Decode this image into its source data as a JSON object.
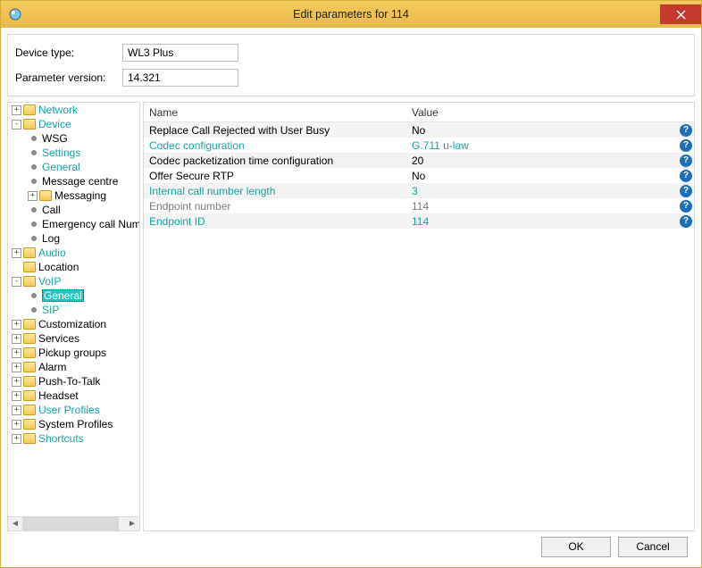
{
  "window": {
    "title": "Edit parameters for 114"
  },
  "info": {
    "device_type_label": "Device type:",
    "device_type_value": "WL3 Plus",
    "param_version_label": "Parameter version:",
    "param_version_value": "14.321"
  },
  "tree": {
    "items": [
      {
        "depth": 0,
        "exp": "+",
        "kind": "folder",
        "label": "Network",
        "link": true
      },
      {
        "depth": 0,
        "exp": "-",
        "kind": "folder",
        "label": "Device",
        "link": true
      },
      {
        "depth": 1,
        "exp": "",
        "kind": "leaf",
        "label": "WSG"
      },
      {
        "depth": 1,
        "exp": "",
        "kind": "leaf",
        "label": "Settings",
        "link": true
      },
      {
        "depth": 1,
        "exp": "",
        "kind": "leaf",
        "label": "General",
        "link": true
      },
      {
        "depth": 1,
        "exp": "",
        "kind": "leaf",
        "label": "Message centre"
      },
      {
        "depth": 1,
        "exp": "+",
        "kind": "folder",
        "label": "Messaging"
      },
      {
        "depth": 1,
        "exp": "",
        "kind": "leaf",
        "label": "Call"
      },
      {
        "depth": 1,
        "exp": "",
        "kind": "leaf",
        "label": "Emergency call Num"
      },
      {
        "depth": 1,
        "exp": "",
        "kind": "leaf",
        "label": "Log"
      },
      {
        "depth": 0,
        "exp": "+",
        "kind": "folder",
        "label": "Audio",
        "link": true
      },
      {
        "depth": 0,
        "exp": "",
        "kind": "folder",
        "label": "Location"
      },
      {
        "depth": 0,
        "exp": "-",
        "kind": "folder",
        "label": "VoIP",
        "link": true
      },
      {
        "depth": 1,
        "exp": "",
        "kind": "leaf",
        "label": "General",
        "selected": true
      },
      {
        "depth": 1,
        "exp": "",
        "kind": "leaf",
        "label": "SIP",
        "link": true
      },
      {
        "depth": 0,
        "exp": "+",
        "kind": "folder",
        "label": "Customization"
      },
      {
        "depth": 0,
        "exp": "+",
        "kind": "folder",
        "label": "Services"
      },
      {
        "depth": 0,
        "exp": "+",
        "kind": "folder",
        "label": "Pickup groups"
      },
      {
        "depth": 0,
        "exp": "+",
        "kind": "folder",
        "label": "Alarm"
      },
      {
        "depth": 0,
        "exp": "+",
        "kind": "folder",
        "label": "Push-To-Talk"
      },
      {
        "depth": 0,
        "exp": "+",
        "kind": "folder",
        "label": "Headset"
      },
      {
        "depth": 0,
        "exp": "+",
        "kind": "folder",
        "label": "User Profiles",
        "link": true
      },
      {
        "depth": 0,
        "exp": "+",
        "kind": "folder",
        "label": "System Profiles"
      },
      {
        "depth": 0,
        "exp": "+",
        "kind": "folder",
        "label": "Shortcuts",
        "link": true
      }
    ]
  },
  "grid": {
    "headers": {
      "name": "Name",
      "value": "Value"
    },
    "rows": [
      {
        "alt": true,
        "name": "Replace Call Rejected with User Busy",
        "value": "No"
      },
      {
        "alt": false,
        "name": "Codec configuration",
        "value": "G.711 u-law",
        "link": true
      },
      {
        "alt": true,
        "name": "Codec packetization time configuration",
        "value": "20"
      },
      {
        "alt": false,
        "name": "Offer Secure RTP",
        "value": "No"
      },
      {
        "alt": true,
        "name": "Internal call number length",
        "value": "3",
        "link": true
      },
      {
        "alt": false,
        "name": "Endpoint number",
        "value": "114",
        "dim": true
      },
      {
        "alt": true,
        "name": "Endpoint ID",
        "value": "114",
        "link": true
      }
    ]
  },
  "footer": {
    "ok": "OK",
    "cancel": "Cancel"
  }
}
